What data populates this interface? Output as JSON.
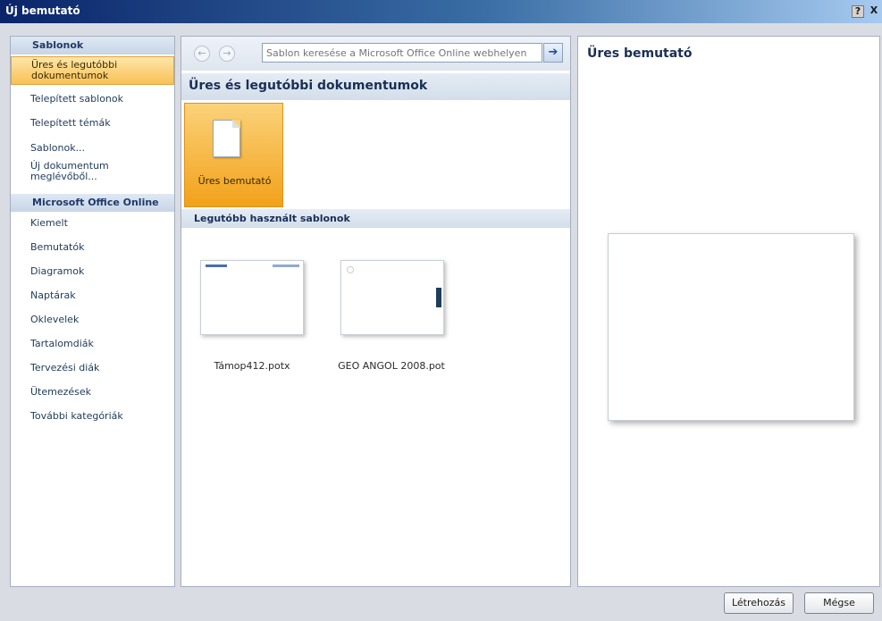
{
  "window": {
    "title": "Új bemutató",
    "help_label": "?",
    "close_label": "X"
  },
  "sidebar": {
    "sablonok_header": "Sablonok",
    "items_top": [
      {
        "label": "Üres és legutóbbi\ndokumentumok",
        "selected": true
      },
      {
        "label": "Telepített sablonok"
      },
      {
        "label": "Telepített témák"
      },
      {
        "label": "Sablonok..."
      },
      {
        "label": "Új dokumentum\nmeglévőből..."
      }
    ],
    "online_header": "Microsoft Office Online",
    "items_online": [
      {
        "label": "Kiemelt"
      },
      {
        "label": "Bemutatók"
      },
      {
        "label": "Diagramok"
      },
      {
        "label": "Naptárak"
      },
      {
        "label": "Oklevelek"
      },
      {
        "label": "Tartalomdiák"
      },
      {
        "label": "Tervezési diák"
      },
      {
        "label": "Ütemezések"
      },
      {
        "label": "További kategóriák"
      }
    ]
  },
  "middle": {
    "back_icon": "back-arrow-icon",
    "forward_icon": "forward-arrow-icon",
    "search_placeholder": "Sablon keresése a Microsoft Office Online webhelyen",
    "search_go_icon": "right-arrow-icon",
    "heading": "Üres és legutóbbi dokumentumok",
    "blank_tile_label": "Üres bemutató",
    "recent_header": "Legutóbb használt sablonok",
    "recent_templates": [
      {
        "label": "Támop412.potx"
      },
      {
        "label": "GEO ANGOL 2008.pot"
      }
    ]
  },
  "preview": {
    "title": "Üres bemutató"
  },
  "buttons": {
    "create": "Létrehozás",
    "cancel": "Mégse"
  }
}
